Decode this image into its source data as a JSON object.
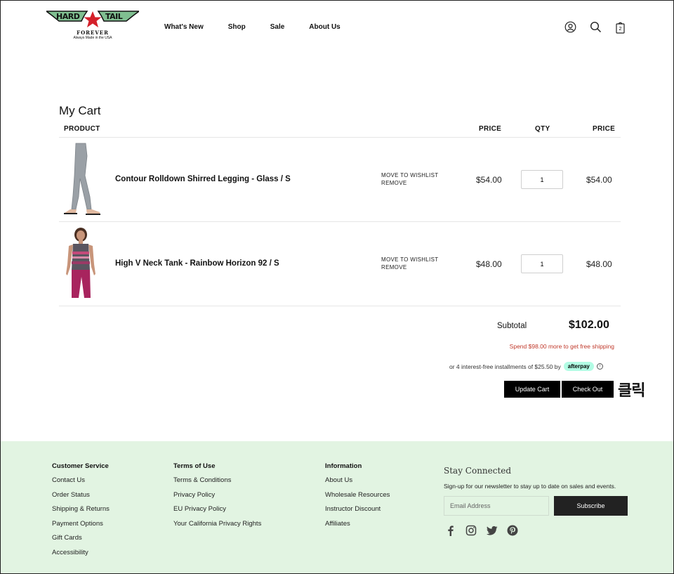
{
  "brand": {
    "logo_word_left": "HARD",
    "logo_word_right": "TAIL",
    "logo_subtitle": "FOREVER",
    "logo_tagline": "Always Made in the USA"
  },
  "nav": [
    "What's New",
    "Shop",
    "Sale",
    "About Us"
  ],
  "header_icons": [
    "account-icon",
    "search-icon",
    "bag-icon"
  ],
  "bag_count": "2",
  "cart": {
    "title": "My Cart",
    "headers": {
      "product": "PRODUCT",
      "price": "PRICE",
      "qty": "QTY",
      "total": "PRICE"
    },
    "items": [
      {
        "name": "Contour Rolldown Shirred Legging - Glass / S",
        "wishlist": "MOVE TO WISHLIST",
        "remove": "REMOVE",
        "price": "$54.00",
        "qty": "1",
        "total": "$54.00"
      },
      {
        "name": "High V Neck Tank - Rainbow Horizon 92 / S",
        "wishlist": "MOVE TO WISHLIST",
        "remove": "REMOVE",
        "price": "$48.00",
        "qty": "1",
        "total": "$48.00"
      }
    ],
    "subtotal_label": "Subtotal",
    "subtotal_value": "$102.00",
    "free_shipping": "Spend $98.00 more to get free shipping",
    "afterpay_text": "or 4 interest-free installments of $25.50 by",
    "afterpay_badge": "afterpay",
    "update_button": "Update Cart",
    "checkout_button": "Check Out",
    "annotation": "클릭"
  },
  "footer": {
    "customer_service": {
      "title": "Customer Service",
      "links": [
        "Contact Us",
        "Order Status",
        "Shipping & Returns",
        "Payment Options",
        "Gift Cards",
        "Accessibility"
      ]
    },
    "terms": {
      "title": "Terms of Use",
      "links": [
        "Terms & Conditions",
        "Privacy Policy",
        "EU Privacy Policy",
        "Your California Privacy Rights"
      ]
    },
    "information": {
      "title": "Information",
      "links": [
        "About Us",
        "Wholesale Resources",
        "Instructor Discount",
        "Affiliates"
      ]
    },
    "newsletter": {
      "title": "Stay Connected",
      "description": "Sign-up for our newsletter to stay up to date on sales and events.",
      "email_placeholder": "Email Address",
      "subscribe_button": "Subscribe"
    },
    "social": [
      "facebook-icon",
      "instagram-icon",
      "twitter-icon",
      "pinterest-icon"
    ]
  },
  "colors": {
    "footer_bg": "#e2f4e2",
    "button_bg": "#000000",
    "free_shipping_text": "#c0392b",
    "afterpay_badge": "#b2fce4",
    "logo_star": "#d4202a",
    "logo_wings": "#7fbf90"
  }
}
